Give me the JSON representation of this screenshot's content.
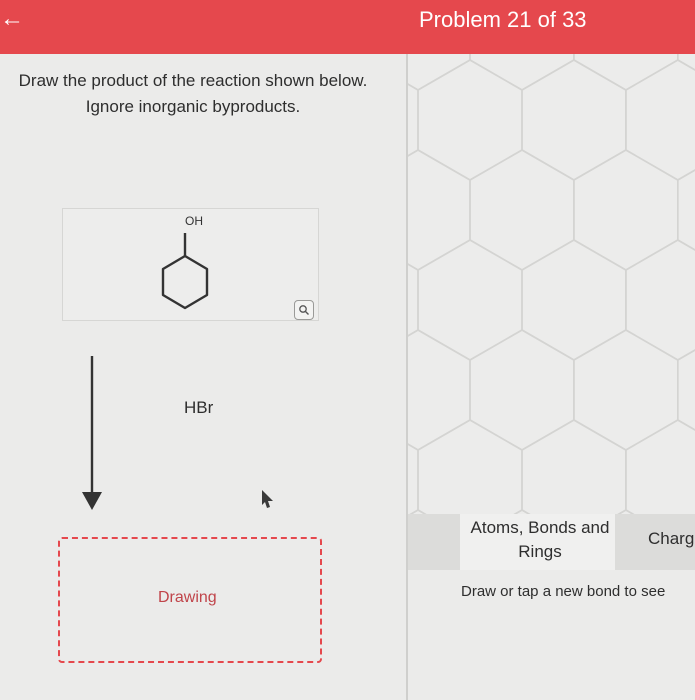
{
  "header": {
    "back_icon": "arrow-left-icon",
    "title": "Problem 21 of 33",
    "color": "#e5484d"
  },
  "question": {
    "text": "Draw the product of the reaction shown below. Ignore inorganic byproducts."
  },
  "reactant": {
    "label": "OH",
    "structure": "cyclohexanol"
  },
  "reaction": {
    "reagent": "HBr"
  },
  "answer": {
    "placeholder": "Drawing"
  },
  "toolbar": {
    "tabs": [
      {
        "label": "Atoms, Bonds and Rings"
      },
      {
        "label": "Charg"
      }
    ]
  },
  "canvas": {
    "hint": "Draw or tap a new bond to see"
  }
}
